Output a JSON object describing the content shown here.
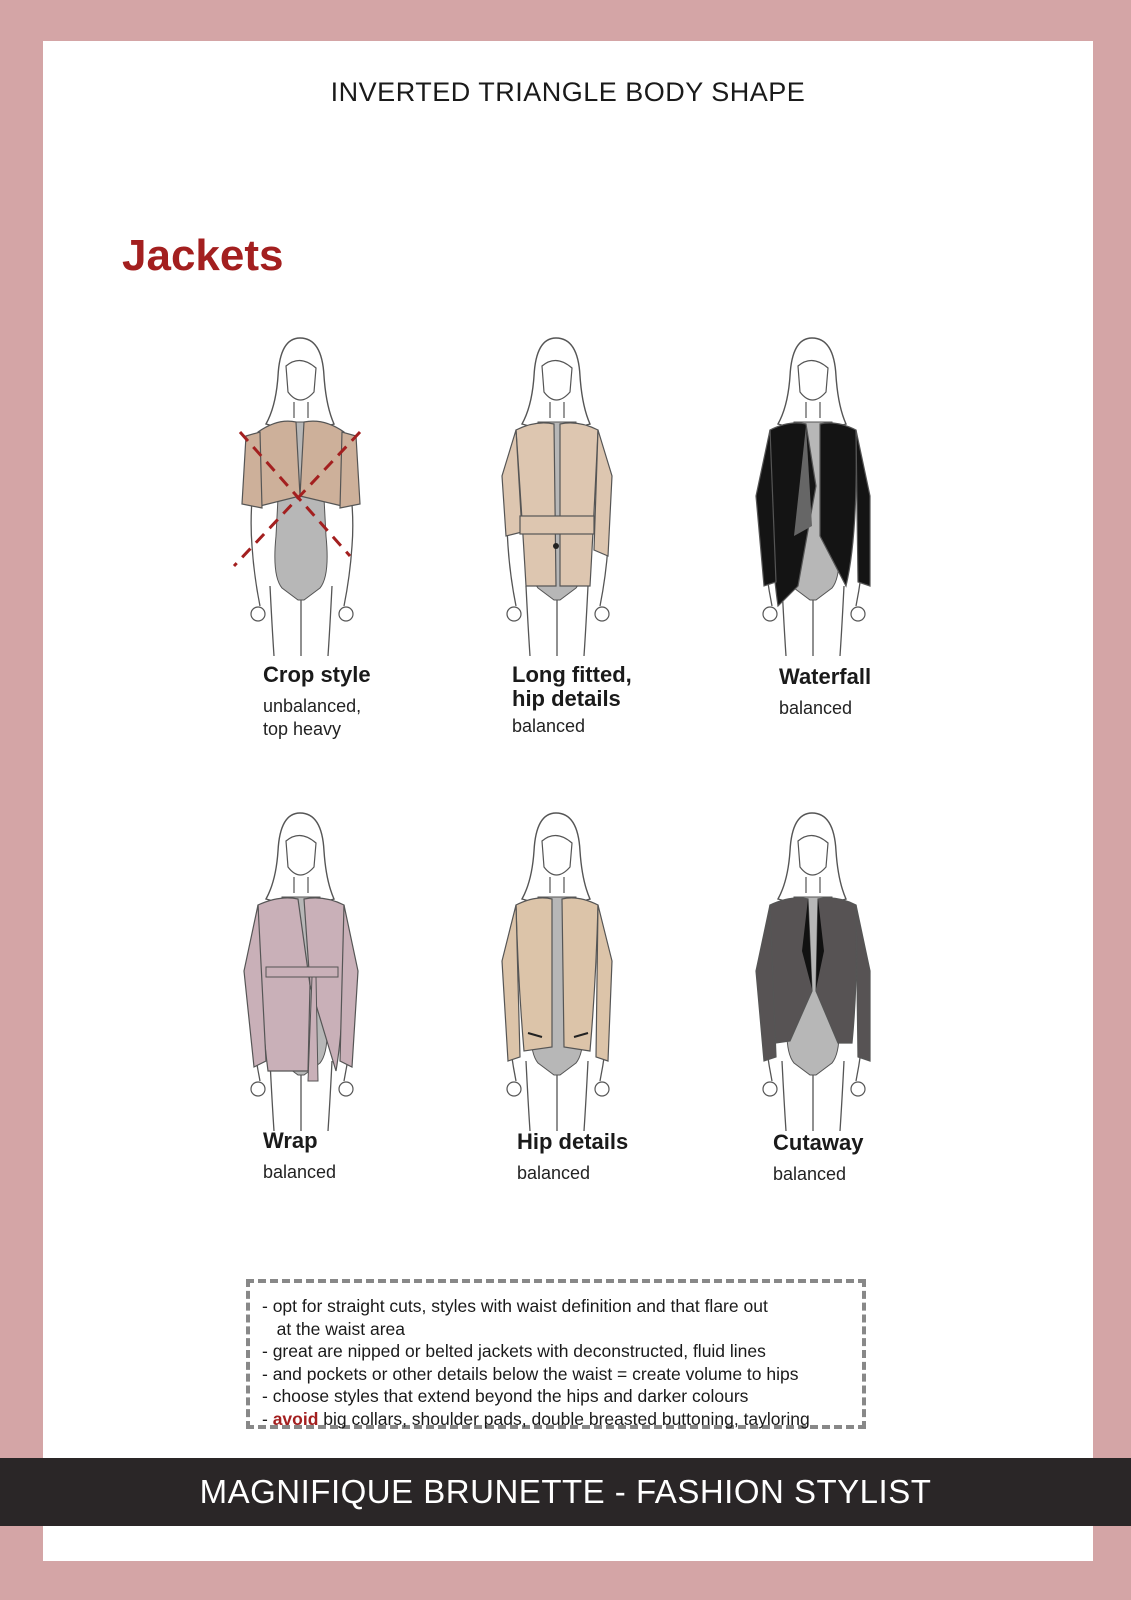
{
  "header": {
    "title": "INVERTED TRIANGLE BODY SHAPE"
  },
  "section": {
    "title": "Jackets"
  },
  "styles": [
    {
      "name": "Crop style",
      "verdict": "unbalanced,\ntop heavy",
      "jacket_color": "#cdb09a",
      "crossed_out": true,
      "icon": "crop-jacket-figure"
    },
    {
      "name": "Long fitted,\nhip details",
      "verdict": "balanced",
      "jacket_color": "#ddc6b0",
      "crossed_out": false,
      "icon": "long-fitted-jacket-figure"
    },
    {
      "name": "Waterfall",
      "verdict": "balanced",
      "jacket_color": "#141414",
      "crossed_out": false,
      "icon": "waterfall-jacket-figure"
    },
    {
      "name": "Wrap",
      "verdict": "balanced",
      "jacket_color": "#c9b0b8",
      "crossed_out": false,
      "icon": "wrap-jacket-figure"
    },
    {
      "name": "Hip details",
      "verdict": "balanced",
      "jacket_color": "#dcc4a9",
      "crossed_out": false,
      "icon": "hip-details-jacket-figure"
    },
    {
      "name": "Cutaway",
      "verdict": "balanced",
      "jacket_color": "#575354",
      "crossed_out": false,
      "icon": "cutaway-jacket-figure"
    }
  ],
  "tips": [
    "- opt for straight cuts, styles with waist definition and that flare out",
    "   at the waist area",
    "- great are nipped or belted jackets with deconstructed, fluid lines",
    "- and pockets or other details below the waist = create volume to hips",
    "- choose styles that extend beyond the hips and darker colours"
  ],
  "avoid_tip": {
    "prefix": "- ",
    "keyword": "avoid",
    "rest": " big collars, shoulder pads, double breasted buttoning, tayloring"
  },
  "footer": {
    "text": "MAGNIFIQUE BRUNETTE - FASHION STYLIST"
  },
  "colors": {
    "page_border": "#d4a5a6",
    "accent_red": "#a31f1f",
    "footer_bg": "#2a2627",
    "bodysuit_grey": "#b7b7b7"
  }
}
